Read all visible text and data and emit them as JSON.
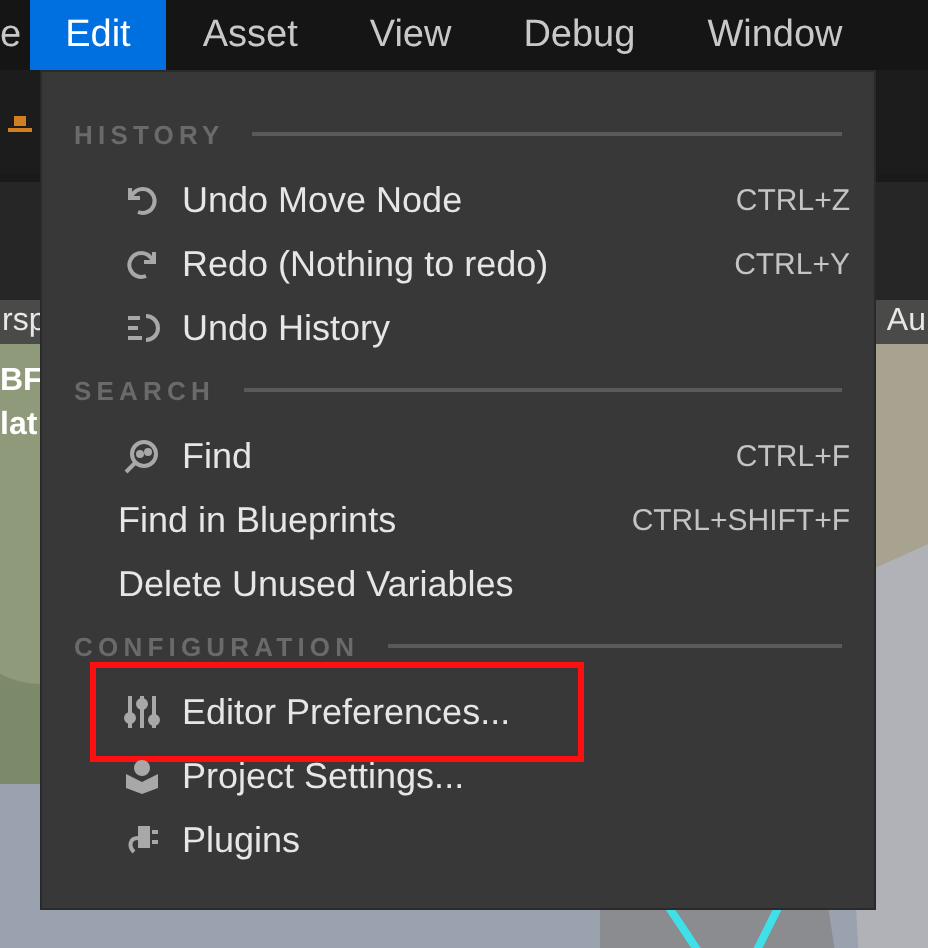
{
  "menu_bar": [
    {
      "label": "e",
      "selected": false
    },
    {
      "label": "Edit",
      "selected": true
    },
    {
      "label": "Asset",
      "selected": false
    },
    {
      "label": "View",
      "selected": false
    },
    {
      "label": "Debug",
      "selected": false
    },
    {
      "label": "Window",
      "selected": false
    }
  ],
  "background": {
    "tab_left": "rsp",
    "tab_right": "Au",
    "overlay_lines": [
      "BF",
      "lat"
    ]
  },
  "edit_menu": {
    "sections": [
      {
        "heading": "HISTORY",
        "items": [
          {
            "label": "Undo Move Node",
            "shortcut": "CTRL+Z",
            "has_icon": true,
            "highlighted": false
          },
          {
            "label": "Redo (Nothing to redo)",
            "shortcut": "CTRL+Y",
            "has_icon": true,
            "highlighted": false
          },
          {
            "label": "Undo History",
            "has_icon": true,
            "highlighted": false
          }
        ]
      },
      {
        "heading": "SEARCH",
        "items": [
          {
            "label": "Find",
            "shortcut": "CTRL+F",
            "has_icon": true,
            "highlighted": false
          },
          {
            "label": "Find in Blueprints",
            "shortcut": "CTRL+SHIFT+F",
            "has_icon": false,
            "highlighted": false
          },
          {
            "label": "Delete Unused Variables",
            "has_icon": false,
            "highlighted": false
          }
        ]
      },
      {
        "heading": "CONFIGURATION",
        "items": [
          {
            "label": "Editor Preferences...",
            "has_icon": true,
            "highlighted": true
          },
          {
            "label": "Project Settings...",
            "has_icon": true,
            "highlighted": false
          },
          {
            "label": "Plugins",
            "has_icon": true,
            "highlighted": false
          }
        ]
      }
    ]
  }
}
